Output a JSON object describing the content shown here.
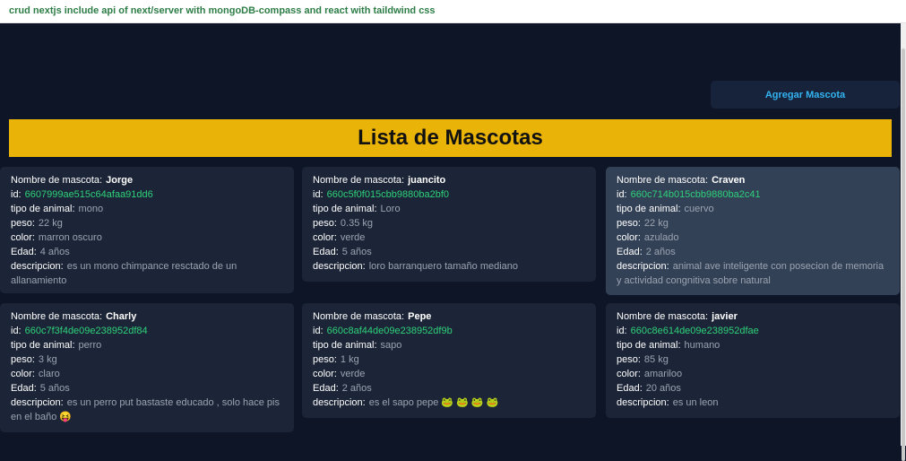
{
  "header": {
    "title": "crud nextjs include api of next/server with mongoDB-compass and react with taildwind css"
  },
  "actions": {
    "add_label": "Agregar Mascota"
  },
  "page": {
    "title": "Lista de Mascotas"
  },
  "labels": {
    "name": "Nombre de mascota:",
    "id": "id:",
    "type": "tipo de animal:",
    "weight": "peso:",
    "color": "color:",
    "age": "Edad:",
    "description": "descripcion:"
  },
  "pets": [
    {
      "name": "Jorge",
      "id": "6607999ae515c64afaa91dd6",
      "type": "mono",
      "weight": "22 kg",
      "color": "marron oscuro",
      "age": "4 años",
      "description": "es un mono chimpance resctado de un allanamiento"
    },
    {
      "name": "juancito",
      "id": "660c5f0f015cbb9880ba2bf0",
      "type": "Loro",
      "weight": "0.35 kg",
      "color": "verde",
      "age": "5 años",
      "description": "loro barranquero tamaño mediano"
    },
    {
      "name": "Craven",
      "id": "660c714b015cbb9880ba2c41",
      "type": "cuervo",
      "weight": "22 kg",
      "color": "azulado",
      "age": "2 años",
      "description": "animal ave inteligente con posecion de memoria y actividad congnitiva sobre natural"
    },
    {
      "name": "Charly",
      "id": "660c7f3f4de09e238952df84",
      "type": "perro",
      "weight": "3 kg",
      "color": "claro",
      "age": "5 años",
      "description": "es un perro put bastaste educado , solo hace pis en el baño 😝"
    },
    {
      "name": "Pepe",
      "id": "660c8af44de09e238952df9b",
      "type": "sapo",
      "weight": "1 kg",
      "color": "verde",
      "age": "2 años",
      "description": "es el sapo pepe 🐸 🐸 🐸 🐸"
    },
    {
      "name": "javier",
      "id": "660c8e614de09e238952dfae",
      "type": "humano",
      "weight": "85 kg",
      "color": "amariloo",
      "age": "20 años",
      "description": "es un leon"
    }
  ]
}
